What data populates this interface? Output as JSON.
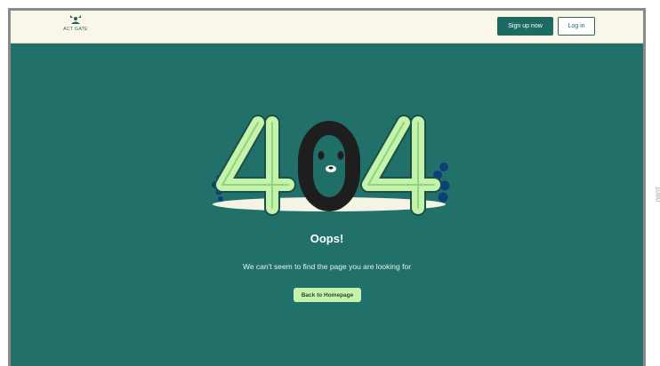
{
  "header": {
    "brand": "ACT GATE",
    "signup_label": "Sign up now",
    "login_label": "Log in"
  },
  "error": {
    "code_digits": [
      "4",
      "0",
      "4"
    ],
    "title": "Oops!",
    "message": "We can't seem to find the page you are looking for",
    "home_label": "Back to Homepage"
  },
  "ruler": {
    "height_label": "1080"
  },
  "colors": {
    "page_background": "#22706a",
    "header_background": "#faf7ea",
    "primary_button": "#1d6a63",
    "digit_green": "#c4f3a9",
    "digit_dark": "#1e1e1e",
    "bubble_blue": "#0d3f7a"
  }
}
